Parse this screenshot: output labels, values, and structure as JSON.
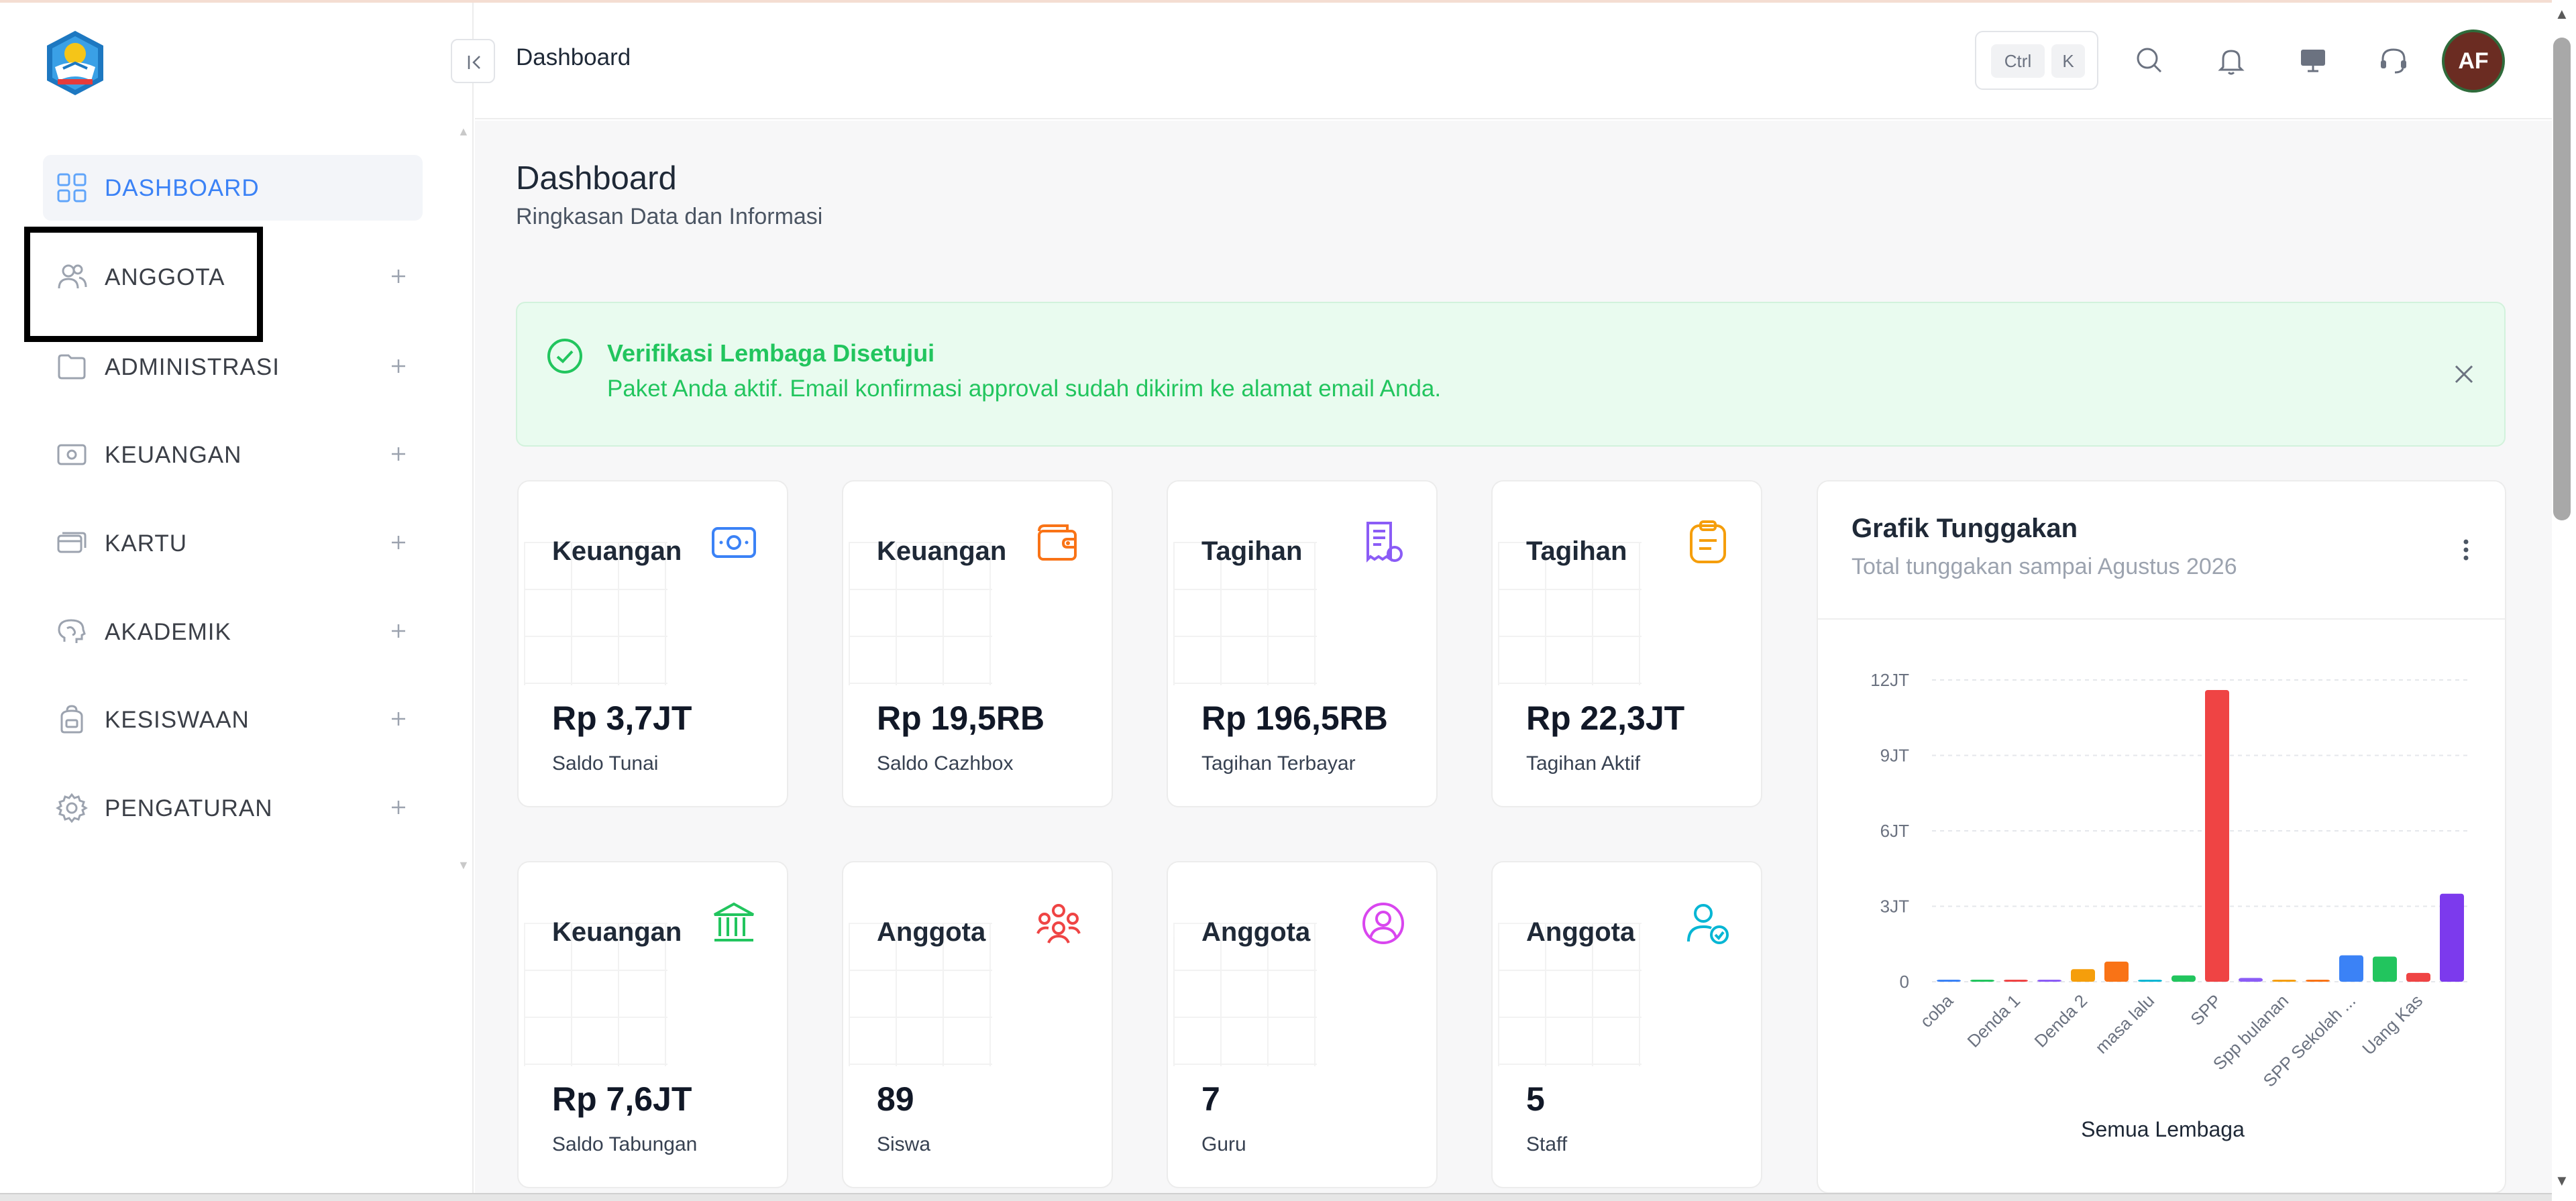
{
  "sidebar": {
    "items": [
      {
        "label": "DASHBOARD",
        "icon": "grid-icon",
        "active": true
      },
      {
        "label": "ANGGOTA",
        "icon": "users-icon",
        "active": false
      },
      {
        "label": "ADMINISTRASI",
        "icon": "folder-icon",
        "active": false
      },
      {
        "label": "KEUANGAN",
        "icon": "money-icon",
        "active": false
      },
      {
        "label": "KARTU",
        "icon": "card-icon",
        "active": false
      },
      {
        "label": "AKADEMIK",
        "icon": "brain-icon",
        "active": false
      },
      {
        "label": "KESISWAAN",
        "icon": "backpack-icon",
        "active": false
      },
      {
        "label": "PENGATURAN",
        "icon": "gear-icon",
        "active": false
      }
    ]
  },
  "topbar": {
    "title": "Dashboard",
    "shortcut": {
      "ctrl": "Ctrl",
      "key": "K"
    },
    "avatar_initials": "AF"
  },
  "page": {
    "title": "Dashboard",
    "subtitle": "Ringkasan Data dan Informasi"
  },
  "alert": {
    "title": "Verifikasi Lembaga Disetujui",
    "message": "Paket Anda aktif. Email konfirmasi approval sudah dikirim ke alamat email Anda."
  },
  "cards": [
    {
      "title": "Keuangan",
      "value": "Rp 3,7JT",
      "label": "Saldo Tunai",
      "icon": "cash-icon",
      "color": "#3b82f6"
    },
    {
      "title": "Keuangan",
      "value": "Rp 19,5RB",
      "label": "Saldo Cazhbox",
      "icon": "wallet-icon",
      "color": "#f97316"
    },
    {
      "title": "Tagihan",
      "value": "Rp 196,5RB",
      "label": "Tagihan Terbayar",
      "icon": "receipt-icon",
      "color": "#8b5cf6"
    },
    {
      "title": "Tagihan",
      "value": "Rp 22,3JT",
      "label": "Tagihan Aktif",
      "icon": "clipboard-icon",
      "color": "#f59e0b"
    },
    {
      "title": "Keuangan",
      "value": "Rp 7,6JT",
      "label": "Saldo Tabungan",
      "icon": "bank-icon",
      "color": "#22c55e"
    },
    {
      "title": "Anggota",
      "value": "89",
      "label": "Siswa",
      "icon": "group-icon",
      "color": "#ef4444"
    },
    {
      "title": "Anggota",
      "value": "7",
      "label": "Guru",
      "icon": "user-circle-icon",
      "color": "#d946ef"
    },
    {
      "title": "Anggota",
      "value": "5",
      "label": "Staff",
      "icon": "user-check-icon",
      "color": "#06b6d4"
    }
  ],
  "chart_card": {
    "title": "Grafik Tunggakan",
    "subtitle": "Total tunggakan sampai Agustus 2026",
    "footer": "Semua Lembaga"
  },
  "chart_data": {
    "type": "bar",
    "title": "Grafik Tunggakan",
    "xlabel": "Semua Lembaga",
    "ylabel": "",
    "ylim": [
      0,
      12000000
    ],
    "yticks": [
      0,
      3000000,
      6000000,
      9000000,
      12000000
    ],
    "ytick_labels": [
      "0",
      "3JT",
      "6JT",
      "9JT",
      "12JT"
    ],
    "x_tick_labels": [
      "coba",
      "Denda 1",
      "Denda 2",
      "masa lalu",
      "SPP",
      "Spp bulanan",
      "SPP Sekolah ...",
      "Uang Kas"
    ],
    "grid": true,
    "categories": [
      "coba",
      "",
      "Denda 1",
      "",
      "Denda 2",
      "",
      "masa lalu",
      "",
      "SPP",
      "",
      "Spp bulanan",
      "",
      "SPP Sekolah ...",
      "",
      "Uang Kas"
    ],
    "values": [
      40000,
      40000,
      60000,
      60000,
      500000,
      800000,
      40000,
      250000,
      11600000,
      150000,
      80000,
      0,
      1050000,
      1000000,
      350000,
      3500000
    ],
    "colors": [
      "#3b82f6",
      "#22c55e",
      "#ef4444",
      "#8b5cf6",
      "#f59e0b",
      "#f97316",
      "#06b6d4",
      "#22c55e",
      "#ef4444",
      "#8b5cf6",
      "#f59e0b",
      "#f97316",
      "#3b82f6",
      "#22c55e",
      "#ef4444",
      "#7c3aed"
    ]
  }
}
